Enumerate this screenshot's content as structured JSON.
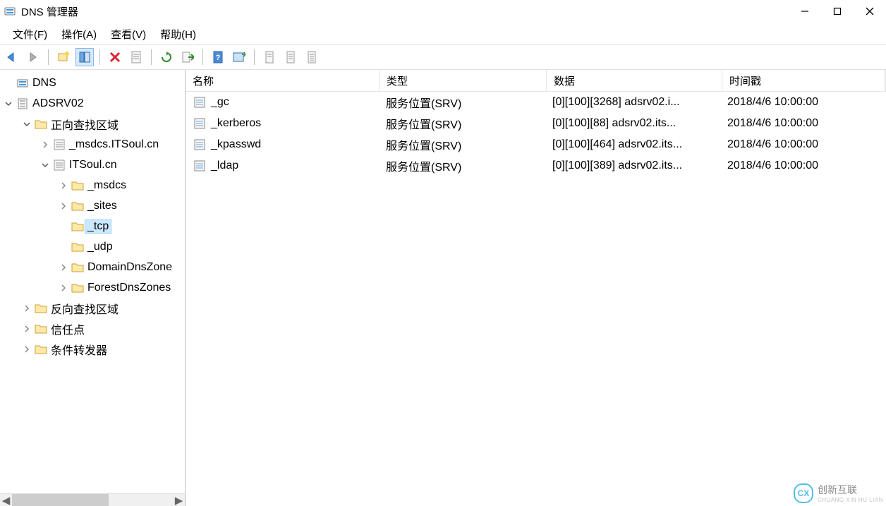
{
  "window": {
    "title": "DNS 管理器"
  },
  "menu": {
    "file": "文件(F)",
    "action": "操作(A)",
    "view": "查看(V)",
    "help": "帮助(H)"
  },
  "toolbar_icons": {
    "back": "back",
    "forward": "fwd",
    "up": "up",
    "show_hide": "showhide",
    "delete": "delete",
    "properties": "props",
    "refresh": "refresh",
    "export": "export",
    "help": "help",
    "new_window": "newwin",
    "info1": "i1",
    "info2": "i2",
    "info3": "i3"
  },
  "tree": {
    "root": "DNS",
    "server": "ADSRV02",
    "fwd_zone": "正向查找区域",
    "msdcs_itsoul": "_msdcs.ITSoul.cn",
    "itsoul": "ITSoul.cn",
    "msdcs": "_msdcs",
    "sites": "_sites",
    "tcp": "_tcp",
    "udp": "_udp",
    "domdnszones": "DomainDnsZone",
    "forestdnszones": "ForestDnsZones",
    "rev_zone": "反向查找区域",
    "trust": "信任点",
    "cond_fwd": "条件转发器"
  },
  "columns": {
    "name": "名称",
    "type": "类型",
    "data": "数据",
    "ts": "时间戳"
  },
  "rows": [
    {
      "name": "_gc",
      "type": "服务位置(SRV)",
      "data": "[0][100][3268] adsrv02.i...",
      "ts": "2018/4/6 10:00:00"
    },
    {
      "name": "_kerberos",
      "type": "服务位置(SRV)",
      "data": "[0][100][88] adsrv02.its...",
      "ts": "2018/4/6 10:00:00"
    },
    {
      "name": "_kpasswd",
      "type": "服务位置(SRV)",
      "data": "[0][100][464] adsrv02.its...",
      "ts": "2018/4/6 10:00:00"
    },
    {
      "name": "_ldap",
      "type": "服务位置(SRV)",
      "data": "[0][100][389] adsrv02.its...",
      "ts": "2018/4/6 10:00:00"
    }
  ],
  "watermark": {
    "text": "创新互联",
    "sub": "CHUANG XIN HU LIAN"
  }
}
